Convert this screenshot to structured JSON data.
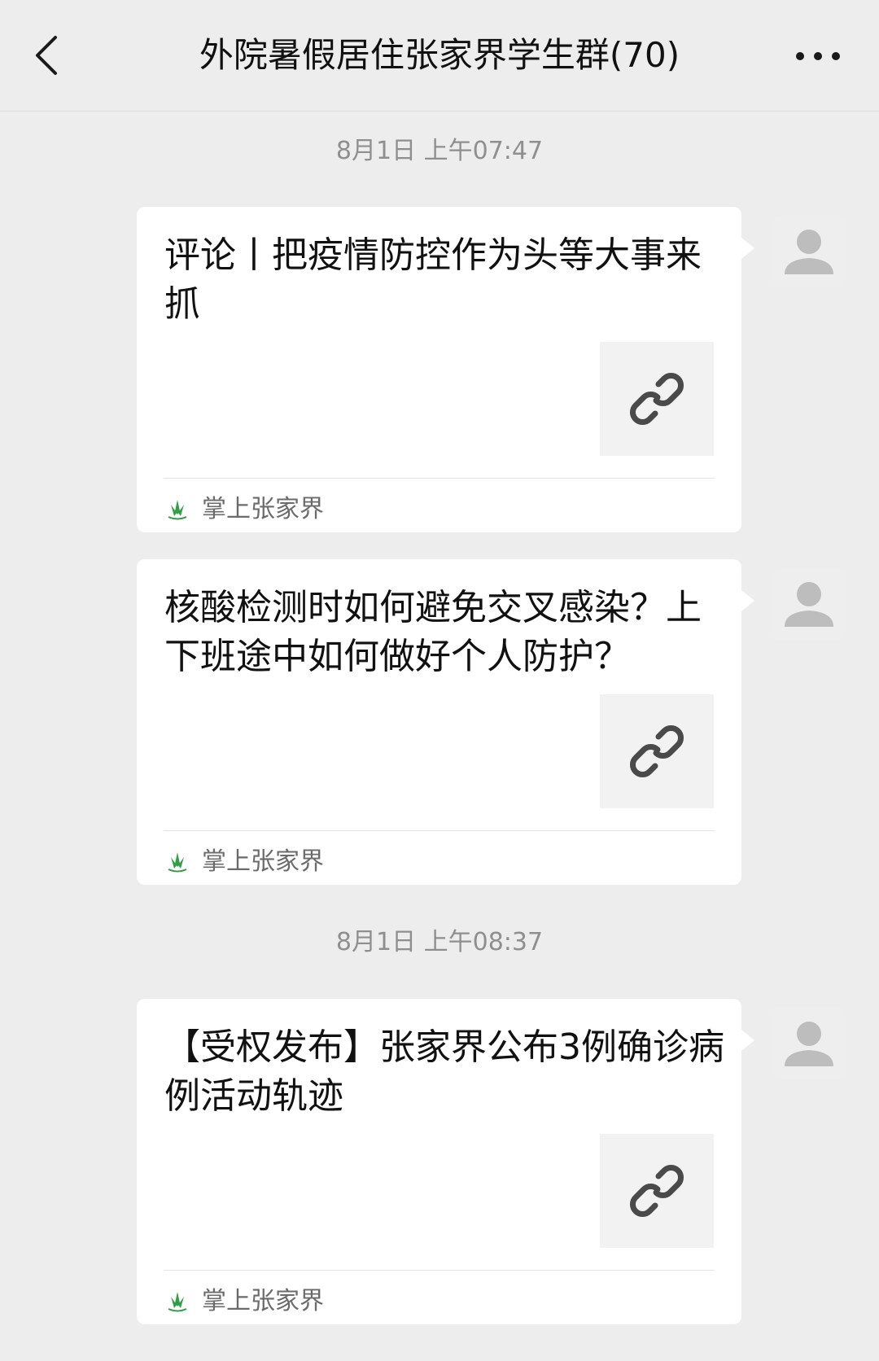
{
  "header": {
    "title": "外院暑假居住张家界学生群(70)"
  },
  "icons": {
    "back": "chevron-left-icon",
    "more": "more-horizontal-icon",
    "link": "link-icon",
    "source_logo": "zhangjiajie-logo-icon",
    "avatar": "default-avatar-icon"
  },
  "colors": {
    "background": "#ededed",
    "bubble": "#ffffff",
    "timestamp": "#8f8f8f",
    "source_logo": "#2f9e44"
  },
  "timestamps": [
    "8月1日 上午07:47",
    "8月1日 上午08:37"
  ],
  "messages": [
    {
      "title": "评论丨把疫情防控作为头等大事来抓",
      "source": "掌上张家界"
    },
    {
      "title": "核酸检测时如何避免交叉感染？上下班途中如何做好个人防护？",
      "source": "掌上张家界"
    },
    {
      "title": "【受权发布】张家界公布3例确诊病例活动轨迹",
      "source": "掌上张家界"
    }
  ]
}
